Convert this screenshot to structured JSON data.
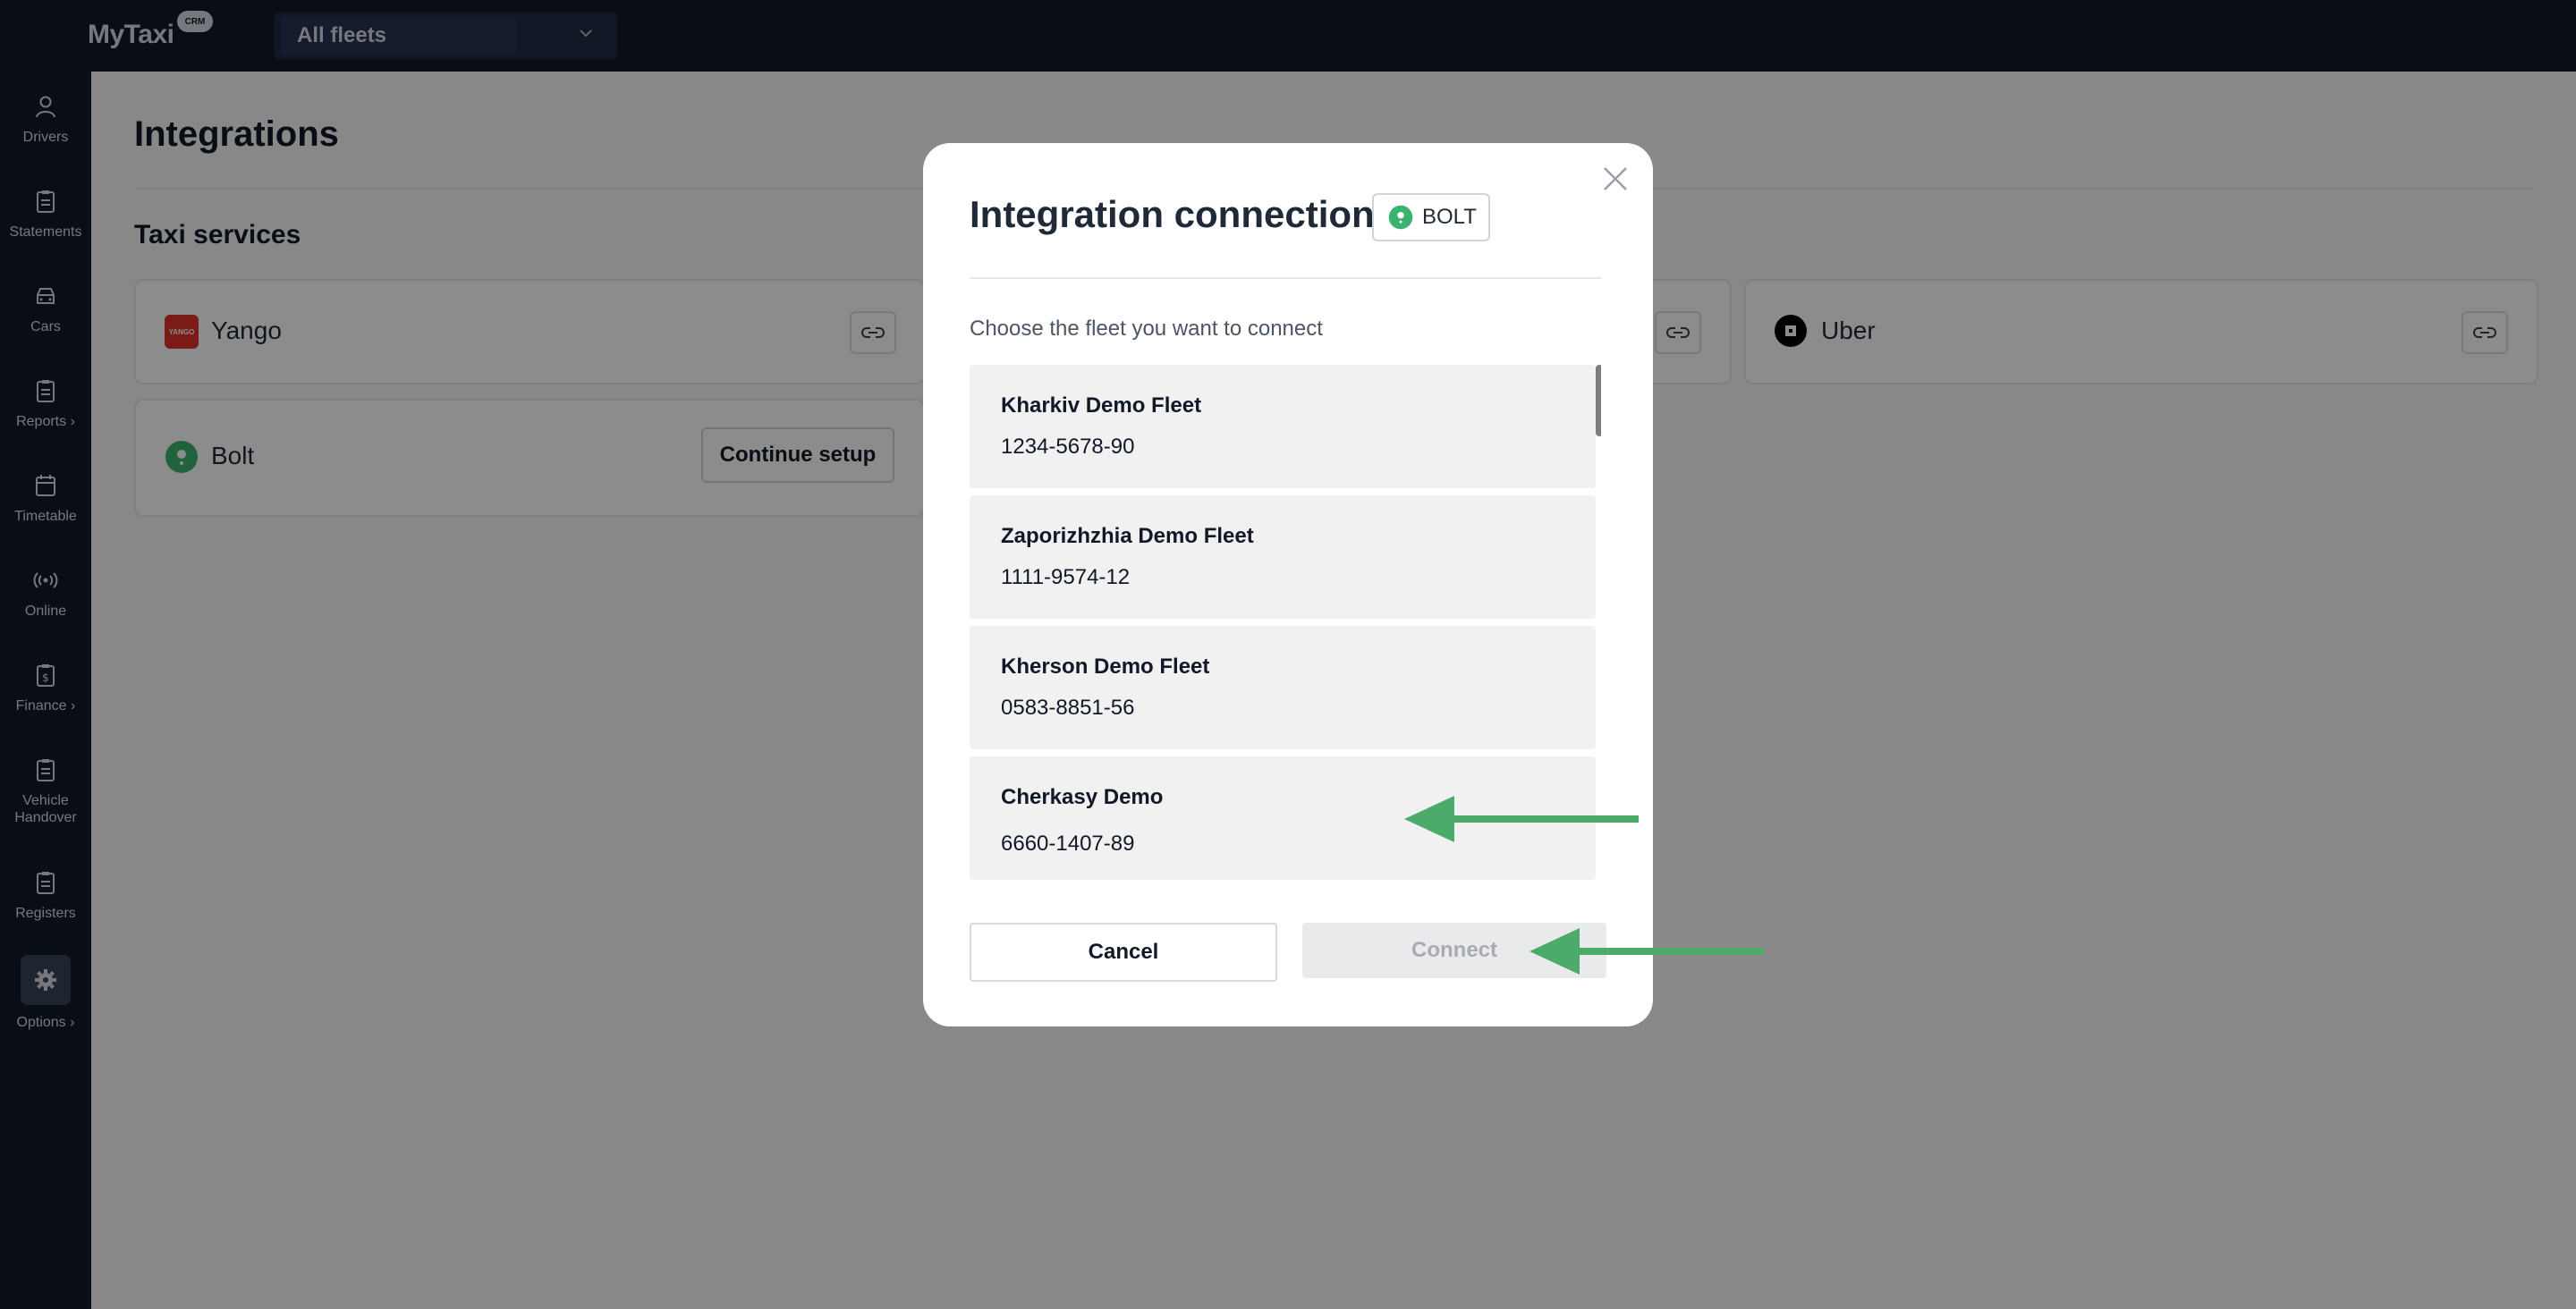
{
  "app": {
    "logo": "MyTaxi",
    "logo_badge": "CRM"
  },
  "fleet_selector": {
    "value": "All fleets"
  },
  "sidebar": {
    "items": [
      {
        "label": "Drivers",
        "icon": "person-icon"
      },
      {
        "label": "Statements",
        "icon": "clipboard-icon"
      },
      {
        "label": "Cars",
        "icon": "car-icon"
      },
      {
        "label": "Reports ›",
        "icon": "clipboard-icon"
      },
      {
        "label": "Timetable",
        "icon": "calendar-icon"
      },
      {
        "label": "Online",
        "icon": "broadcast-icon"
      },
      {
        "label": "Finance ›",
        "icon": "dollar-clipboard-icon"
      },
      {
        "label": "Vehicle Handover",
        "icon": "clipboard-icon"
      },
      {
        "label": "Registers",
        "icon": "clipboard-icon"
      },
      {
        "label": "Options ›",
        "icon": "gear-icon"
      }
    ]
  },
  "main": {
    "title": "Integrations",
    "section": "Taxi services",
    "services": [
      {
        "name": "Yango"
      },
      {
        "name": "Uber"
      },
      {
        "name": "Bolt",
        "action": "Continue setup"
      }
    ]
  },
  "modal": {
    "title": "Integration connection",
    "badge": "BOLT",
    "subtitle": "Choose the fleet you want to connect",
    "fleets": [
      {
        "name": "Kharkiv Demo Fleet",
        "code": "1234-5678-90"
      },
      {
        "name": "Zaporizhzhia Demo Fleet",
        "code": "1111-9574-12"
      },
      {
        "name": "Kherson Demo Fleet",
        "code": "0583-8851-56"
      },
      {
        "name": "Cherkasy Demo",
        "code": "6660-1407-89"
      }
    ],
    "cancel_label": "Cancel",
    "connect_label": "Connect"
  },
  "colors": {
    "topbar": "#111827",
    "annotation_arrow": "#4caa6a",
    "bolt_green": "#3bb26e",
    "yango_red": "#e0322a"
  }
}
